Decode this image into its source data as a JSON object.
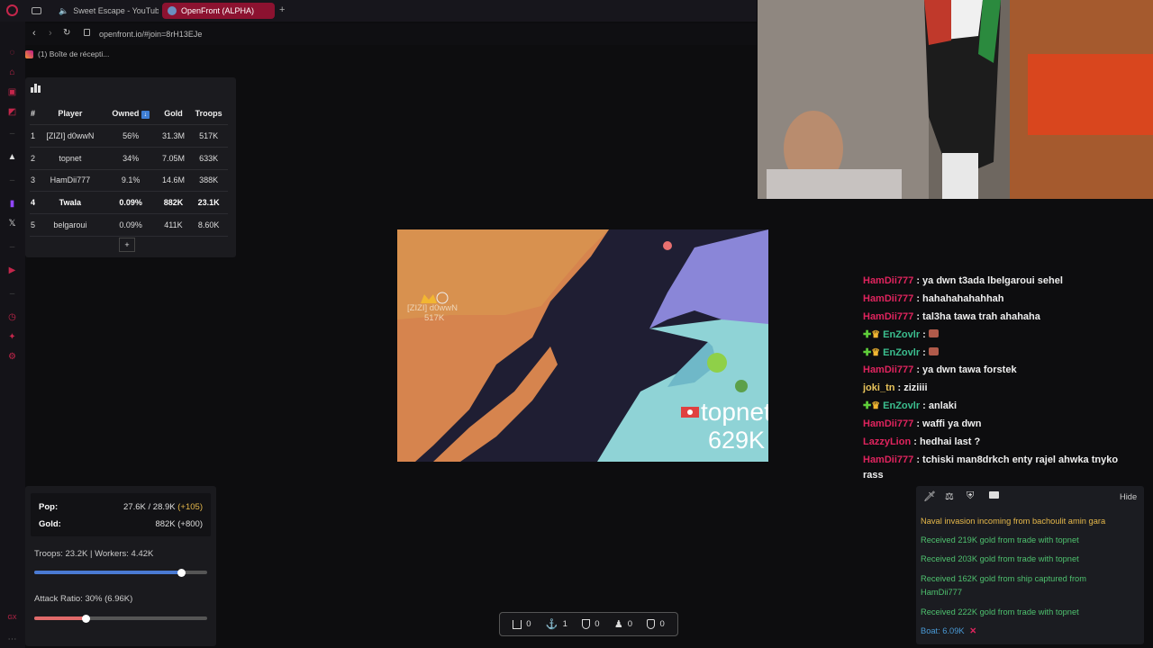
{
  "browser": {
    "tabs": [
      {
        "label": "Sweet Escape - YouTube"
      },
      {
        "label": "OpenFront (ALPHA)"
      }
    ],
    "new_tab_label": "+",
    "url": "openfront.io/#join=8rH13EJe",
    "bookmark": "(1) Boîte de récepti..."
  },
  "leaderboard": {
    "headers": [
      "#",
      "Player",
      "Owned",
      "Gold",
      "Troops"
    ],
    "rows": [
      {
        "rank": "1",
        "player": "[ZIZI] d0wwN",
        "owned": "56%",
        "gold": "31.3M",
        "troops": "517K"
      },
      {
        "rank": "2",
        "player": "topnet",
        "owned": "34%",
        "gold": "7.05M",
        "troops": "633K"
      },
      {
        "rank": "3",
        "player": "HamDii777",
        "owned": "9.1%",
        "gold": "14.6M",
        "troops": "388K"
      },
      {
        "rank": "4",
        "player": "Twala",
        "owned": "0.09%",
        "gold": "882K",
        "troops": "23.1K"
      },
      {
        "rank": "5",
        "player": "belgaroui",
        "owned": "0.09%",
        "gold": "411K",
        "troops": "8.60K"
      }
    ],
    "expand_label": "+"
  },
  "map": {
    "label_zizi_name": "[ZIZI] d0wwN",
    "label_zizi_troops": "517K",
    "label_topnet_name": "topnet",
    "label_topnet_troops": "629K"
  },
  "chat": [
    {
      "user": "HamDii777",
      "color": "#e0245e",
      "text": " : ya dwn t3ada lbelgaroui sehel"
    },
    {
      "user": "HamDii777",
      "color": "#e0245e",
      "text": " : hahahahahahhah"
    },
    {
      "user": "HamDii777",
      "color": "#e0245e",
      "text": " : tal3ha tawa trah ahahaha"
    },
    {
      "user": "EnZovlr",
      "color": "#3bbf8f",
      "text": " : ",
      "badges": true,
      "emote": true
    },
    {
      "user": "EnZovlr",
      "color": "#3bbf8f",
      "text": " : ",
      "badges": true,
      "emote": true
    },
    {
      "user": "HamDii777",
      "color": "#e0245e",
      "text": " : ya dwn tawa forstek"
    },
    {
      "user": "joki_tn",
      "color": "#e8c35a",
      "text": " : ziziiii"
    },
    {
      "user": "EnZovlr",
      "color": "#3bbf8f",
      "text": " : anlaki",
      "badges": true
    },
    {
      "user": "HamDii777",
      "color": "#e0245e",
      "text": " : waffi ya dwn"
    },
    {
      "user": "LazzyLion",
      "color": "#e0245e",
      "text": " : hedhai last ?"
    },
    {
      "user": "HamDii777",
      "color": "#e0245e",
      "text": " : tchiski man8drkch enty rajel ahwka tnyko"
    }
  ],
  "chat_wrap": "rass",
  "events": {
    "hide_label": "Hide",
    "items": [
      {
        "text": "Naval invasion incoming from bachoulit amin gara",
        "color": "#e6b84a"
      },
      {
        "text": "Received 219K gold from trade with topnet",
        "color": "#4ec06e"
      },
      {
        "text": "Received 203K gold from trade with topnet",
        "color": "#4ec06e"
      },
      {
        "text": "Received 162K gold from ship captured from",
        "color": "#4ec06e"
      },
      {
        "text": "HamDii777",
        "color": "#4ec06e"
      },
      {
        "text": "Received 222K gold from trade with topnet",
        "color": "#4ec06e"
      }
    ],
    "boat_label": "Boat: 6.09K",
    "boat_close": "✕"
  },
  "stats": {
    "pop_label": "Pop:",
    "pop_value": "27.6K / 28.9K",
    "pop_delta": "(+105)",
    "gold_label": "Gold:",
    "gold_value": "882K (+800)",
    "troops_workers": "Troops: 23.2K | Workers: 4.42K",
    "troops_slider_value": 0.85,
    "attack_ratio": "Attack Ratio: 30% (6.96K)",
    "attack_slider_value": 0.3
  },
  "bottom_bar": [
    {
      "icon": "city-icon",
      "count": "0"
    },
    {
      "icon": "anchor-icon",
      "count": "1"
    },
    {
      "icon": "shield-icon",
      "count": "0"
    },
    {
      "icon": "missile-icon",
      "count": "0"
    },
    {
      "icon": "defense-icon",
      "count": "0"
    }
  ],
  "colors": {
    "accent_red": "#e0245e",
    "slider_blue": "#4a7ad3",
    "slider_red": "#e06a6a"
  }
}
